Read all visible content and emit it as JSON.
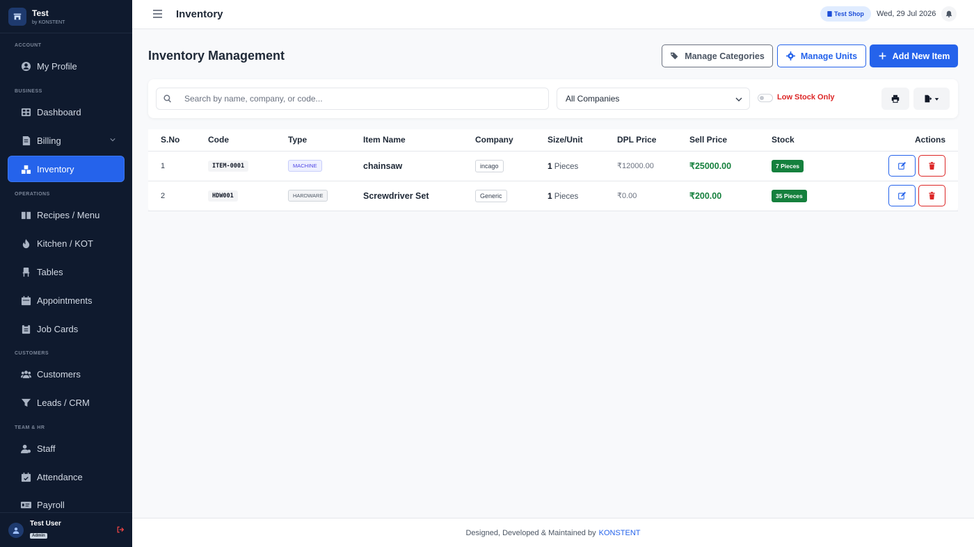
{
  "brand": {
    "title": "Test",
    "subtitle": "by KONSTENT"
  },
  "sidebar": {
    "sections": {
      "account": "ACCOUNT",
      "business": "BUSINESS",
      "operations": "OPERATIONS",
      "customers": "CUSTOMERS",
      "team": "TEAM & HR"
    },
    "items": {
      "profile": "My Profile",
      "dashboard": "Dashboard",
      "billing": "Billing",
      "inventory": "Inventory",
      "recipes": "Recipes / Menu",
      "kitchen": "Kitchen / KOT",
      "tables": "Tables",
      "appointments": "Appointments",
      "jobcards": "Job Cards",
      "customers": "Customers",
      "leads": "Leads / CRM",
      "staff": "Staff",
      "attendance": "Attendance",
      "payroll": "Payroll"
    },
    "user": {
      "name": "Test User",
      "role": "Admin"
    }
  },
  "topbar": {
    "title": "Inventory",
    "shop": "Test Shop",
    "date": "Wed, 29 Jul 2026"
  },
  "main": {
    "title": "Inventory Management",
    "buttons": {
      "categories": "Manage Categories",
      "units": "Manage Units",
      "add": "Add New Item"
    },
    "filters": {
      "search_placeholder": "Search by name, company, or code...",
      "company": "All Companies",
      "low_stock": "Low Stock Only"
    },
    "table": {
      "headers": {
        "sno": "S.No",
        "code": "Code",
        "type": "Type",
        "name": "Item Name",
        "company": "Company",
        "size": "Size/Unit",
        "dpl": "DPL Price",
        "sell": "Sell Price",
        "stock": "Stock",
        "actions": "Actions"
      },
      "rows": [
        {
          "sno": "1",
          "code": "ITEM-0001",
          "type": "MACHINE",
          "name": "chainsaw",
          "company": "incago",
          "size": "1",
          "unit": "Pieces",
          "dpl": "₹12000.00",
          "sell": "₹25000.00",
          "stock": "7 Pieces"
        },
        {
          "sno": "2",
          "code": "HDW001",
          "type": "HARDWARE",
          "name": "Screwdriver Set",
          "company": "Generic",
          "size": "1",
          "unit": "Pieces",
          "dpl": "₹0.00",
          "sell": "₹200.00",
          "stock": "35 Pieces"
        }
      ]
    }
  },
  "footer": {
    "text": "Designed, Developed & Maintained by",
    "link": "KONSTENT"
  },
  "colors": {
    "primary": "#2563eb",
    "sidebar": "#0f1a2e",
    "success": "#15803d",
    "danger": "#dc2626"
  }
}
